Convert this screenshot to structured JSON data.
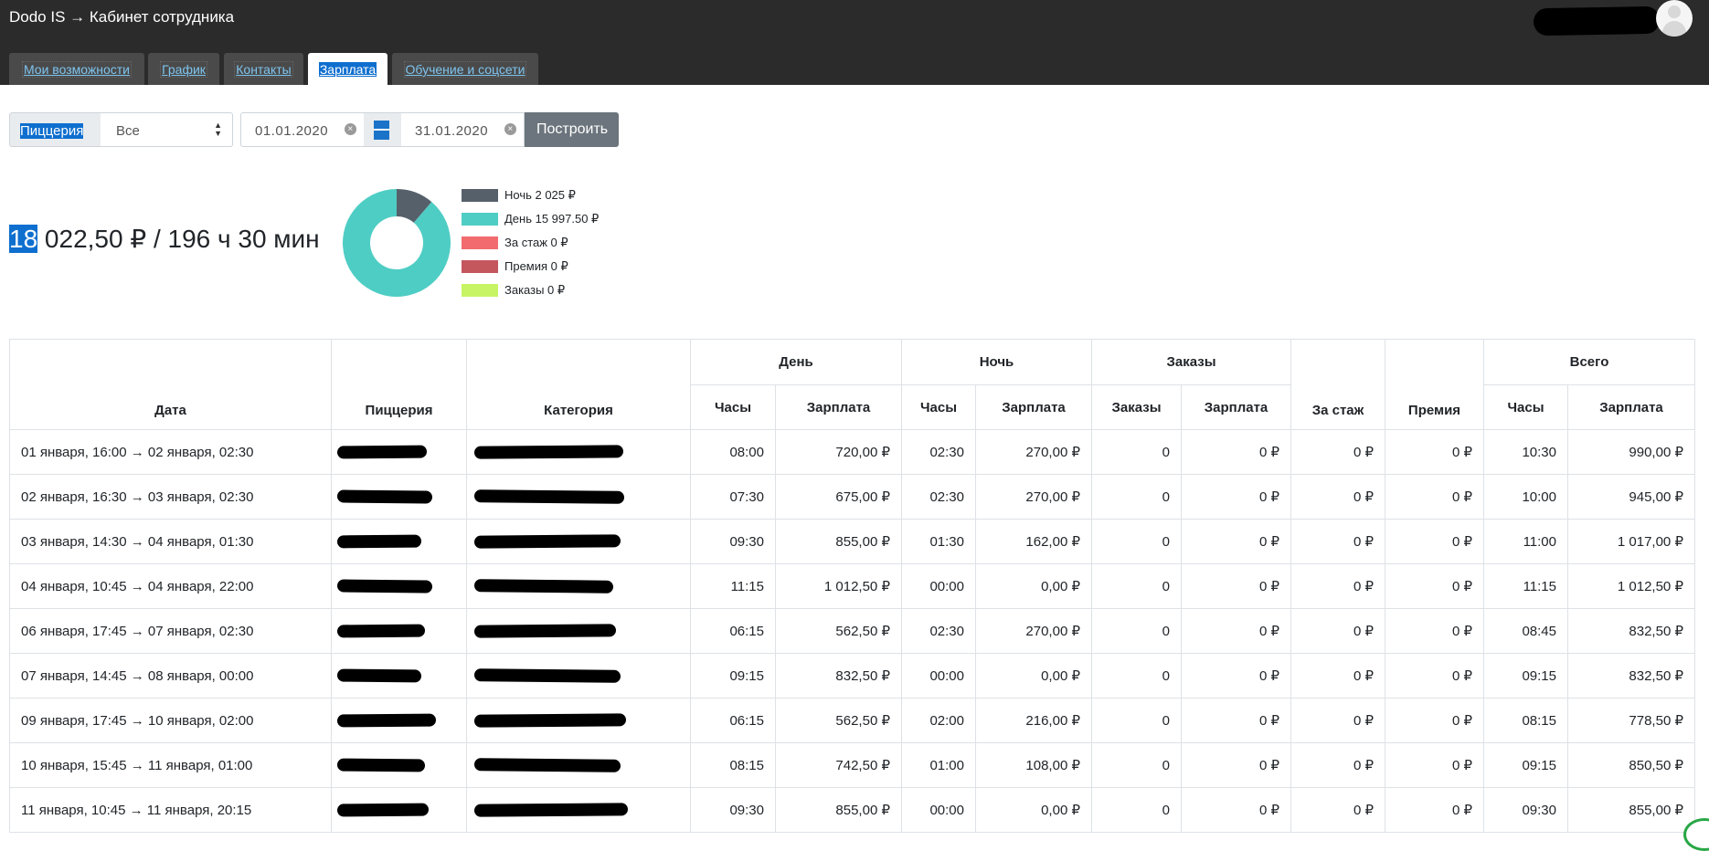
{
  "header": {
    "title": "Dodo IS → Кабинет сотрудника",
    "tabs": [
      {
        "label": "Мои возможности",
        "active": false
      },
      {
        "label": "График",
        "active": false
      },
      {
        "label": "Контакты",
        "active": false
      },
      {
        "label": "Зарплата",
        "active": true
      },
      {
        "label": "Обучение и соцсети",
        "active": false
      }
    ]
  },
  "filters": {
    "pizzeria_label": "Пиццерия",
    "pizzeria_value": "Все",
    "date_from": "01.01.2020",
    "date_to": "31.01.2020",
    "build_label": "Построить"
  },
  "summary": {
    "highlight": "18",
    "rest": " 022,50 ₽ / 196 ч 30 мин"
  },
  "legend": [
    {
      "label": "Ночь 2 025 ₽",
      "color": "#56606b"
    },
    {
      "label": "День 15 997.50 ₽",
      "color": "#4ecdc4"
    },
    {
      "label": "За стаж 0 ₽",
      "color": "#f16b6f"
    },
    {
      "label": "Премия 0 ₽",
      "color": "#c4565e"
    },
    {
      "label": "Заказы 0 ₽",
      "color": "#c7f464"
    }
  ],
  "chart_data": {
    "type": "pie",
    "categories": [
      "Ночь",
      "День",
      "За стаж",
      "Премия",
      "Заказы"
    ],
    "values": [
      2025,
      15997.5,
      0,
      0,
      0
    ],
    "colors": [
      "#56606b",
      "#4ecdc4",
      "#f16b6f",
      "#c4565e",
      "#c7f464"
    ],
    "donut": true
  },
  "table": {
    "group_headers": {
      "day": "День",
      "night": "Ночь",
      "orders": "Заказы",
      "total": "Всего"
    },
    "col_headers": {
      "date": "Дата",
      "pizzeria": "Пиццерия",
      "category": "Категория",
      "day_hours": "Часы",
      "day_salary": "Зарплата",
      "night_hours": "Часы",
      "night_salary": "Зарплата",
      "orders_count": "Заказы",
      "orders_salary": "Зарплата",
      "seniority": "За стаж",
      "bonus": "Премия",
      "total_hours": "Часы",
      "total_salary": "Зарплата"
    },
    "rows": [
      {
        "date": "01 января, 16:00 → 02 января, 02:30",
        "day_h": "08:00",
        "day_s": "720,00 ₽",
        "night_h": "02:30",
        "night_s": "270,00 ₽",
        "orders": "0",
        "orders_s": "0 ₽",
        "seniority": "0 ₽",
        "bonus": "0 ₽",
        "total_h": "10:30",
        "total_s": "990,00 ₽"
      },
      {
        "date": "02 января, 16:30 → 03 января, 02:30",
        "day_h": "07:30",
        "day_s": "675,00 ₽",
        "night_h": "02:30",
        "night_s": "270,00 ₽",
        "orders": "0",
        "orders_s": "0 ₽",
        "seniority": "0 ₽",
        "bonus": "0 ₽",
        "total_h": "10:00",
        "total_s": "945,00 ₽"
      },
      {
        "date": "03 января, 14:30 → 04 января, 01:30",
        "day_h": "09:30",
        "day_s": "855,00 ₽",
        "night_h": "01:30",
        "night_s": "162,00 ₽",
        "orders": "0",
        "orders_s": "0 ₽",
        "seniority": "0 ₽",
        "bonus": "0 ₽",
        "total_h": "11:00",
        "total_s": "1 017,00 ₽"
      },
      {
        "date": "04 января, 10:45 → 04 января, 22:00",
        "day_h": "11:15",
        "day_s": "1 012,50 ₽",
        "night_h": "00:00",
        "night_s": "0,00 ₽",
        "orders": "0",
        "orders_s": "0 ₽",
        "seniority": "0 ₽",
        "bonus": "0 ₽",
        "total_h": "11:15",
        "total_s": "1 012,50 ₽"
      },
      {
        "date": "06 января, 17:45 → 07 января, 02:30",
        "day_h": "06:15",
        "day_s": "562,50 ₽",
        "night_h": "02:30",
        "night_s": "270,00 ₽",
        "orders": "0",
        "orders_s": "0 ₽",
        "seniority": "0 ₽",
        "bonus": "0 ₽",
        "total_h": "08:45",
        "total_s": "832,50 ₽"
      },
      {
        "date": "07 января, 14:45 → 08 января, 00:00",
        "day_h": "09:15",
        "day_s": "832,50 ₽",
        "night_h": "00:00",
        "night_s": "0,00 ₽",
        "orders": "0",
        "orders_s": "0 ₽",
        "seniority": "0 ₽",
        "bonus": "0 ₽",
        "total_h": "09:15",
        "total_s": "832,50 ₽"
      },
      {
        "date": "09 января, 17:45 → 10 января, 02:00",
        "day_h": "06:15",
        "day_s": "562,50 ₽",
        "night_h": "02:00",
        "night_s": "216,00 ₽",
        "orders": "0",
        "orders_s": "0 ₽",
        "seniority": "0 ₽",
        "bonus": "0 ₽",
        "total_h": "08:15",
        "total_s": "778,50 ₽"
      },
      {
        "date": "10 января, 15:45 → 11 января, 01:00",
        "day_h": "08:15",
        "day_s": "742,50 ₽",
        "night_h": "01:00",
        "night_s": "108,00 ₽",
        "orders": "0",
        "orders_s": "0 ₽",
        "seniority": "0 ₽",
        "bonus": "0 ₽",
        "total_h": "09:15",
        "total_s": "850,50 ₽"
      },
      {
        "date": "11 января, 10:45 → 11 января, 20:15",
        "day_h": "09:30",
        "day_s": "855,00 ₽",
        "night_h": "00:00",
        "night_s": "0,00 ₽",
        "orders": "0",
        "orders_s": "0 ₽",
        "seniority": "0 ₽",
        "bonus": "0 ₽",
        "total_h": "09:30",
        "total_s": "855,00 ₽"
      }
    ]
  }
}
